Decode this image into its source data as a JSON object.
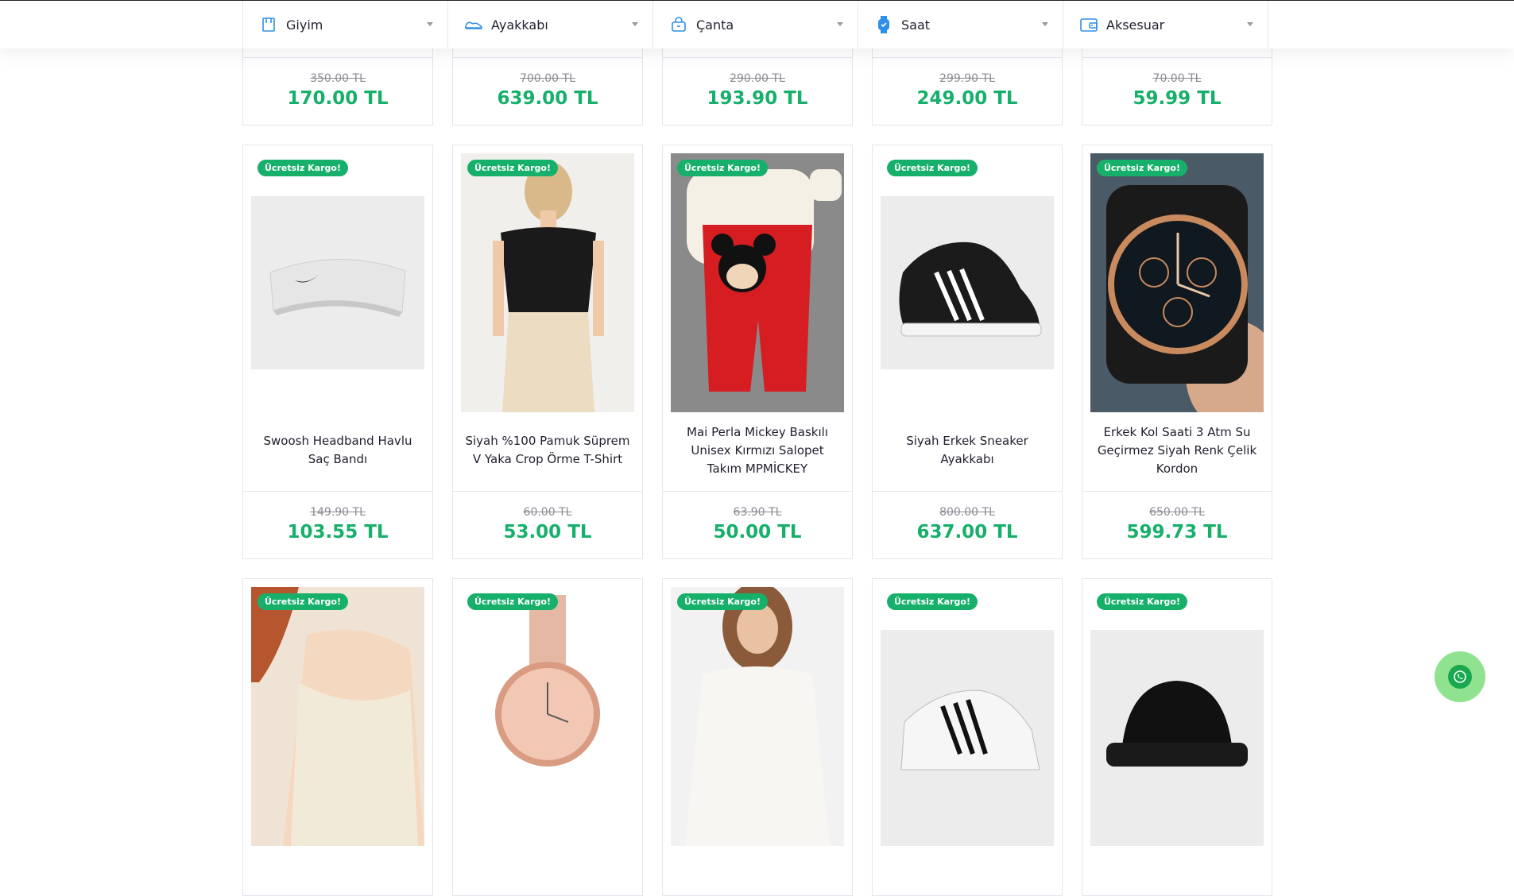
{
  "nav": {
    "categories": [
      {
        "label": "Giyim",
        "icon": "shirt-icon"
      },
      {
        "label": "Ayakkabı",
        "icon": "shoe-icon"
      },
      {
        "label": "Çanta",
        "icon": "bag-icon"
      },
      {
        "label": "Saat",
        "icon": "watch-icon"
      },
      {
        "label": "Aksesuar",
        "icon": "wallet-icon"
      }
    ]
  },
  "colors": {
    "accent": "#16b06b",
    "border": "#e3e6f0",
    "text": "#1f1f2e"
  },
  "row1": [
    {
      "old_price": "350.00 TL",
      "price": "170.00 TL"
    },
    {
      "old_price": "700.00 TL",
      "price": "639.00 TL"
    },
    {
      "old_price": "290.00 TL",
      "price": "193.90 TL"
    },
    {
      "old_price": "299.90 TL",
      "price": "249.00 TL"
    },
    {
      "old_price": "70.00 TL",
      "price": "59.99 TL"
    }
  ],
  "row2": [
    {
      "badge": "Ücretsiz Kargo!",
      "name": "Swoosh Headband Havlu Saç Bandı",
      "old_price": "149.90 TL",
      "price": "103.55 TL"
    },
    {
      "badge": "Ücretsiz Kargo!",
      "name": "Siyah %100 Pamuk Süprem V Yaka Crop Örme T-Shirt",
      "old_price": "60.00 TL",
      "price": "53.00 TL"
    },
    {
      "badge": "Ücretsiz Kargo!",
      "name": "Mai Perla Mickey Baskılı Unisex Kırmızı Salopet Takım MPMİCKEY",
      "old_price": "63.90 TL",
      "price": "50.00 TL"
    },
    {
      "badge": "Ücretsiz Kargo!",
      "name": "Siyah Erkek Sneaker Ayakkabı",
      "old_price": "800.00 TL",
      "price": "637.00 TL"
    },
    {
      "badge": "Ücretsiz Kargo!",
      "name": "Erkek Kol Saati 3 Atm Su Geçirmez Siyah Renk Çelik Kordon",
      "old_price": "650.00 TL",
      "price": "599.73 TL"
    }
  ],
  "row3": [
    {
      "badge": "Ücretsiz Kargo!"
    },
    {
      "badge": "Ücretsiz Kargo!"
    },
    {
      "badge": "Ücretsiz Kargo!"
    },
    {
      "badge": "Ücretsiz Kargo!"
    },
    {
      "badge": "Ücretsiz Kargo!"
    }
  ]
}
